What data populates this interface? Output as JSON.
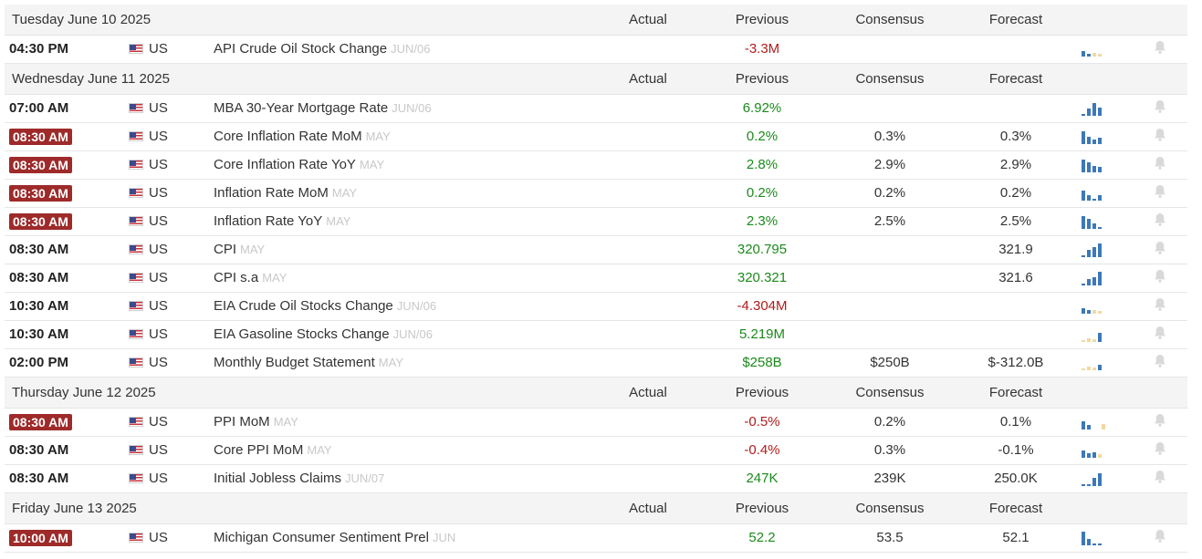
{
  "columns": {
    "actual": "Actual",
    "previous": "Previous",
    "consensus": "Consensus",
    "forecast": "Forecast"
  },
  "icons": {
    "chart": "mini-bar-chart-icon",
    "alert": "bell-icon",
    "flag": "us-flag-icon"
  },
  "colors": {
    "highlight_time": "#9e2a2a",
    "positive": "#1b8a1b",
    "negative": "#b01c1c",
    "bar": "#3d78b8",
    "bar_forecast": "#f0d9a4"
  },
  "days": [
    {
      "date": "Tuesday June 10 2025",
      "events": [
        {
          "time": "04:30 PM",
          "country": "US",
          "name": "API Crude Oil Stock Change",
          "ref": "JUN/06",
          "previous": "-3.3M",
          "consensus": "",
          "forecast": ""
        }
      ]
    },
    {
      "date": "Wednesday June 11 2025",
      "events": [
        {
          "time": "07:00 AM",
          "country": "US",
          "name": "MBA 30-Year Mortgage Rate",
          "ref": "JUN/06",
          "previous": "6.92%",
          "consensus": "",
          "forecast": ""
        },
        {
          "time": "08:30 AM",
          "country": "US",
          "name": "Core Inflation Rate MoM",
          "ref": "MAY",
          "previous": "0.2%",
          "consensus": "0.3%",
          "forecast": "0.3%"
        },
        {
          "time": "08:30 AM",
          "country": "US",
          "name": "Core Inflation Rate YoY",
          "ref": "MAY",
          "previous": "2.8%",
          "consensus": "2.9%",
          "forecast": "2.9%"
        },
        {
          "time": "08:30 AM",
          "country": "US",
          "name": "Inflation Rate MoM",
          "ref": "MAY",
          "previous": "0.2%",
          "consensus": "0.2%",
          "forecast": "0.2%"
        },
        {
          "time": "08:30 AM",
          "country": "US",
          "name": "Inflation Rate YoY",
          "ref": "MAY",
          "previous": "2.3%",
          "consensus": "2.5%",
          "forecast": "2.5%"
        },
        {
          "time": "08:30 AM",
          "country": "US",
          "name": "CPI",
          "ref": "MAY",
          "previous": "320.795",
          "consensus": "",
          "forecast": "321.9"
        },
        {
          "time": "08:30 AM",
          "country": "US",
          "name": "CPI s.a",
          "ref": "MAY",
          "previous": "320.321",
          "consensus": "",
          "forecast": "321.6"
        },
        {
          "time": "10:30 AM",
          "country": "US",
          "name": "EIA Crude Oil Stocks Change",
          "ref": "JUN/06",
          "previous": "-4.304M",
          "consensus": "",
          "forecast": ""
        },
        {
          "time": "10:30 AM",
          "country": "US",
          "name": "EIA Gasoline Stocks Change",
          "ref": "JUN/06",
          "previous": "5.219M",
          "consensus": "",
          "forecast": ""
        },
        {
          "time": "02:00 PM",
          "country": "US",
          "name": "Monthly Budget Statement",
          "ref": "MAY",
          "previous": "$258B",
          "consensus": "$250B",
          "forecast": "$-312.0B"
        }
      ]
    },
    {
      "date": "Thursday June 12 2025",
      "events": [
        {
          "time": "08:30 AM",
          "country": "US",
          "name": "PPI MoM",
          "ref": "MAY",
          "previous": "-0.5%",
          "consensus": "0.2%",
          "forecast": "0.1%"
        },
        {
          "time": "08:30 AM",
          "country": "US",
          "name": "Core PPI MoM",
          "ref": "MAY",
          "previous": "-0.4%",
          "consensus": "0.3%",
          "forecast": "-0.1%"
        },
        {
          "time": "08:30 AM",
          "country": "US",
          "name": "Initial Jobless Claims",
          "ref": "JUN/07",
          "previous": "247K",
          "consensus": "239K",
          "forecast": "250.0K"
        }
      ]
    },
    {
      "date": "Friday June 13 2025",
      "events": [
        {
          "time": "10:00 AM",
          "country": "US",
          "name": "Michigan Consumer Sentiment Prel",
          "ref": "JUN",
          "previous": "52.2",
          "consensus": "53.5",
          "forecast": "52.1"
        }
      ]
    }
  ]
}
